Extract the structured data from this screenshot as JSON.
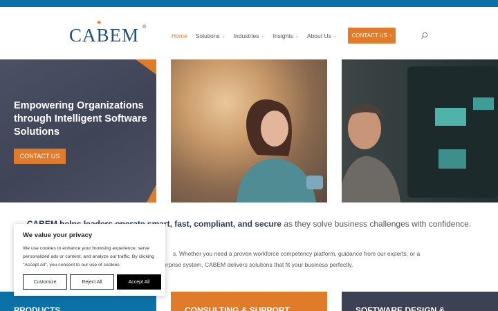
{
  "header": {
    "logo": "CABEM",
    "logo_mark": "®",
    "nav": [
      {
        "label": "Home",
        "active": true,
        "dropdown": false
      },
      {
        "label": "Solutions",
        "active": false,
        "dropdown": true
      },
      {
        "label": "Industries",
        "active": false,
        "dropdown": true
      },
      {
        "label": "Insights",
        "active": false,
        "dropdown": true
      },
      {
        "label": "About Us",
        "active": false,
        "dropdown": true
      }
    ],
    "cta_label": "CONTACT US",
    "cta_arrow": "›",
    "search_icon": "search-icon"
  },
  "hero": {
    "title": "Empowering Organizations through Intelligent Software Solutions",
    "button_label": "CONTACT US"
  },
  "intro": {
    "strong": "CABEM helps leaders operate smart, fast, compliant, and secure",
    "rest": " as they solve business challenges with confidence.",
    "line2a": "s. Whether you need a proven workforce competency platform, guidance from our experts, or a",
    "line2b": "erprise system, CABEM delivers solutions that fit your business perfectly."
  },
  "bands": {
    "products": "PRODUCTS",
    "consulting": "CONSULTING & SUPPORT",
    "software": "SOFTWARE DESIGN &"
  },
  "cookie": {
    "title": "We value your privacy",
    "text": "We use cookies to enhance your browsing experience, serve personalized ads or content, and analyze our traffic. By clicking \"Accept All\", you consent to our use of cookies.",
    "customize": "Customize",
    "reject": "Reject All",
    "accept": "Accept All"
  },
  "colors": {
    "brand_blue": "#0c71a7",
    "accent_orange": "#e07b2a",
    "dark_slate": "#3d4154"
  }
}
